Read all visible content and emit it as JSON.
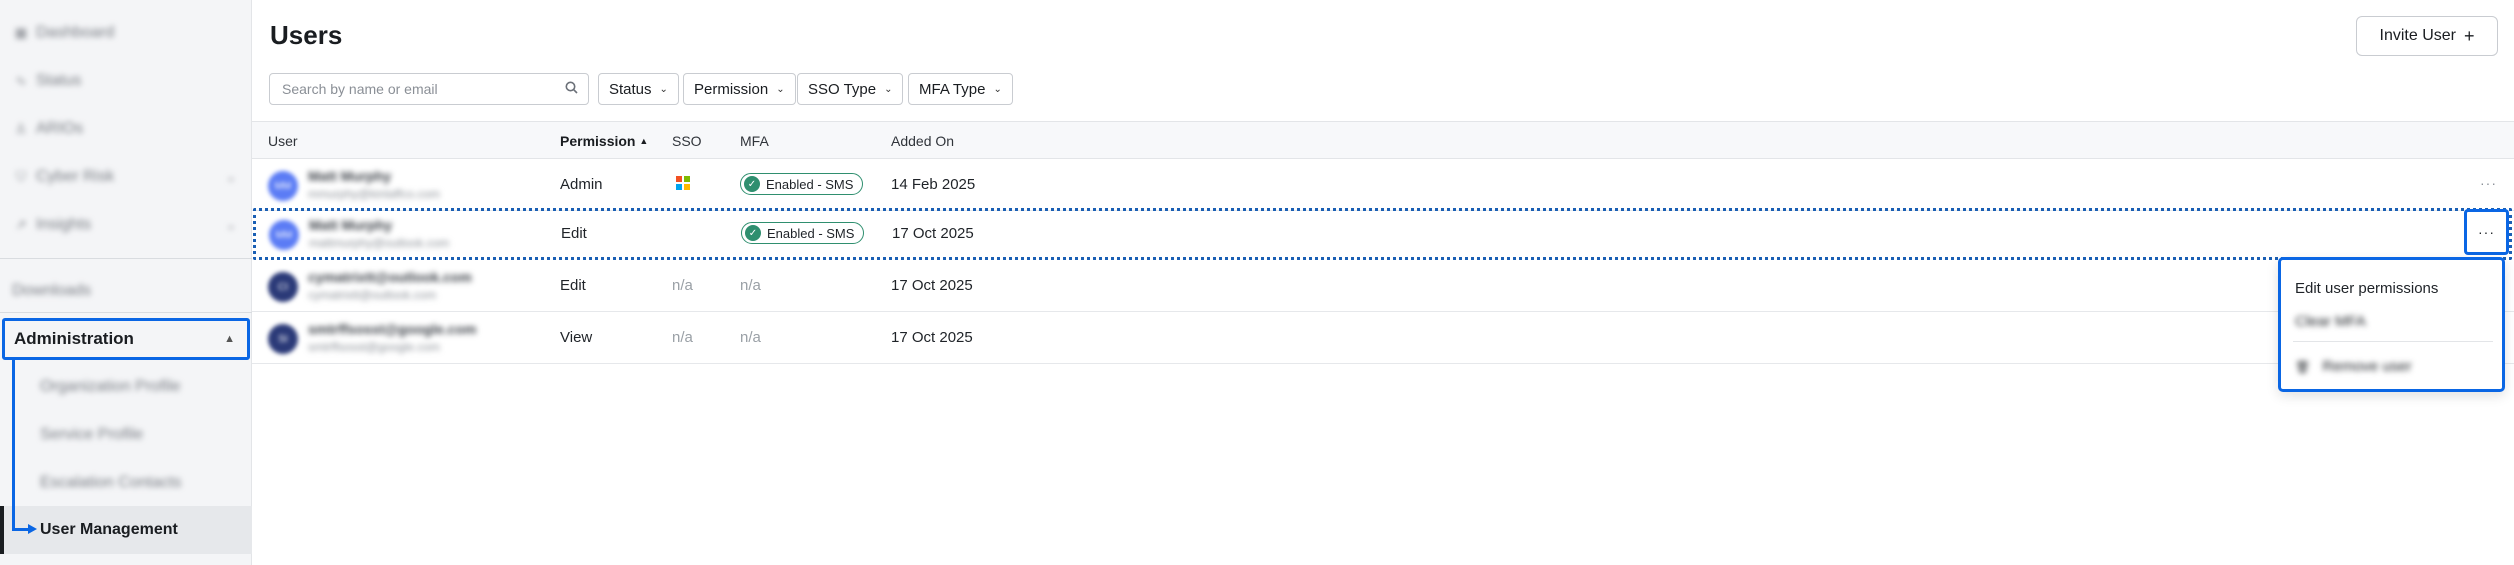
{
  "sidebar": {
    "items": [
      {
        "label": "Dashboard",
        "icon": "grid-icon"
      },
      {
        "label": "Status",
        "icon": "pulse-icon"
      },
      {
        "label": "ARIOs",
        "icon": "person-icon"
      },
      {
        "label": "Cyber Risk",
        "icon": "shield-icon"
      },
      {
        "label": "Insights",
        "icon": "chart-icon"
      }
    ],
    "downloads": "Downloads",
    "administration": "Administration",
    "admin_children": [
      "Organization Profile",
      "Service Profile",
      "Escalation Contacts",
      "User Management"
    ]
  },
  "header": {
    "title": "Users",
    "invite_label": "Invite User",
    "invite_icon": "+"
  },
  "filters": {
    "search_placeholder": "Search by name or email",
    "status": "Status",
    "permission": "Permission",
    "sso_type": "SSO Type",
    "mfa_type": "MFA Type"
  },
  "table": {
    "columns": {
      "user": "User",
      "permission": "Permission",
      "sort_indicator": "▲",
      "sso": "SSO",
      "mfa": "MFA",
      "added_on": "Added On"
    },
    "rows": [
      {
        "initials": "MM",
        "name": "Matt Murphy",
        "email": "mmurphy@kinlaffco.com",
        "permission": "Admin",
        "sso": "microsoft",
        "mfa": "Enabled - SMS",
        "added_on": "14 Feb 2025"
      },
      {
        "initials": "MM",
        "name": "Matt Murphy",
        "email": "mattmurphy@outlook.com",
        "permission": "Edit",
        "sso": "",
        "mfa": "Enabled - SMS",
        "added_on": "17 Oct 2025"
      },
      {
        "initials": "CI",
        "name": "cymatrixtt@outlook.com",
        "email": "cymatrixtt@outlook.com",
        "permission": "Edit",
        "sso": "n/a",
        "mfa": "n/a",
        "added_on": "17 Oct 2025"
      },
      {
        "initials": "SI",
        "name": "smtrffsosst@google.com",
        "email": "smtrffsosst@google.com",
        "permission": "View",
        "sso": "n/a",
        "mfa": "n/a",
        "added_on": "17 Oct 2025"
      }
    ],
    "more_label": "···"
  },
  "context_menu": {
    "edit": "Edit user permissions",
    "clear_mfa": "Clear MFA",
    "remove": "Remove user",
    "remove_icon": "trash-icon"
  },
  "colors": {
    "accent": "#0a66e4",
    "badge_green": "#2f8f6f",
    "avatar_blue": "#5b7cf5",
    "avatar_navy": "#2b3a78"
  }
}
